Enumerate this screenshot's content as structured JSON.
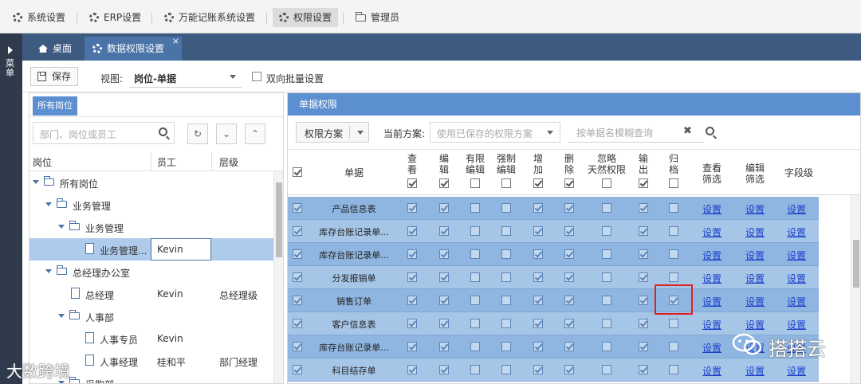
{
  "topmenu": {
    "items": [
      "系统设置",
      "ERP设置",
      "万能记账系统设置",
      "权限设置"
    ],
    "admin": "管理员"
  },
  "leftstrip": {
    "label": "菜单"
  },
  "tabs": {
    "home": "桌面",
    "data_perm": "数据权限设置",
    "close": "×"
  },
  "toolbar": {
    "save": "保存",
    "view_label": "视图:",
    "view_value": "岗位-单据",
    "batch_label": "双向批量设置"
  },
  "leftpanel": {
    "header": "所有岗位",
    "search_placeholder": "部门、岗位或员工",
    "refresh_icon": "↻",
    "expand_icon": "⌄",
    "collapse_icon": "⌃",
    "columns": [
      "岗位",
      "员工",
      "层级"
    ],
    "rows": [
      {
        "name": "所有岗位",
        "employee": "",
        "level": ""
      },
      {
        "name": "业务管理",
        "employee": "",
        "level": ""
      },
      {
        "name": "业务管理",
        "employee": "",
        "level": ""
      },
      {
        "name": "业务管理...",
        "employee": "Kevin",
        "level": ""
      },
      {
        "name": "总经理办公室",
        "employee": "",
        "level": ""
      },
      {
        "name": "总经理",
        "employee": "Kevin",
        "level": "总经理级"
      },
      {
        "name": "人事部",
        "employee": "",
        "level": ""
      },
      {
        "name": "人事专员",
        "employee": "Kevin",
        "level": ""
      },
      {
        "name": "人事经理",
        "employee": "桂和平",
        "level": "部门经理"
      },
      {
        "name": "采购部",
        "employee": "",
        "level": ""
      }
    ]
  },
  "rightpanel": {
    "title": "单据权限",
    "plan_button": "权限方案",
    "current_label": "当前方案:",
    "current_placeholder": "使用已保存的权限方案",
    "search_placeholder": "按单据名模糊查询",
    "clear_icon": "✖",
    "columns": {
      "doc": "单据",
      "view": "查\n看",
      "edit": "编\n辑",
      "own_edit": "有限\n编辑",
      "force_edit": "强制\n编辑",
      "add": "增\n加",
      "delete": "删\n除",
      "ignore": "忽略\n天然权限",
      "export": "输\n出",
      "archive": "归\n档",
      "view_filter": "查看\n筛选",
      "edit_filter": "编辑\n筛选",
      "field_level": "字段级"
    },
    "link_text": "设置",
    "rows": [
      {
        "name": "产品信息表",
        "flags": [
          1,
          1,
          0,
          0,
          1,
          1,
          0,
          1,
          0
        ]
      },
      {
        "name": "库存台账记录单...",
        "flags": [
          1,
          1,
          0,
          0,
          1,
          1,
          0,
          1,
          0
        ]
      },
      {
        "name": "库存台账记录单...",
        "flags": [
          1,
          1,
          0,
          0,
          1,
          1,
          0,
          1,
          0
        ]
      },
      {
        "name": "分发报销单",
        "flags": [
          1,
          1,
          0,
          0,
          1,
          1,
          0,
          1,
          0
        ]
      },
      {
        "name": "销售订单",
        "flags": [
          1,
          1,
          0,
          0,
          1,
          1,
          0,
          1,
          1
        ]
      },
      {
        "name": "客户信息表",
        "flags": [
          1,
          1,
          0,
          0,
          1,
          1,
          0,
          1,
          0
        ]
      },
      {
        "name": "库存台账记录单...",
        "flags": [
          1,
          1,
          0,
          0,
          1,
          1,
          0,
          1,
          0
        ]
      },
      {
        "name": "科目结存单",
        "flags": [
          1,
          1,
          0,
          0,
          1,
          1,
          0,
          1,
          0
        ]
      }
    ]
  },
  "watermarks": {
    "left": "大数跨境",
    "right": "搭搭云"
  },
  "colors": {
    "tabbar": "#3d5a80",
    "panel_title": "#5b8fcf",
    "row": "#8fb6e0",
    "highlight": "#e02020",
    "link": "#1a3ec9"
  }
}
